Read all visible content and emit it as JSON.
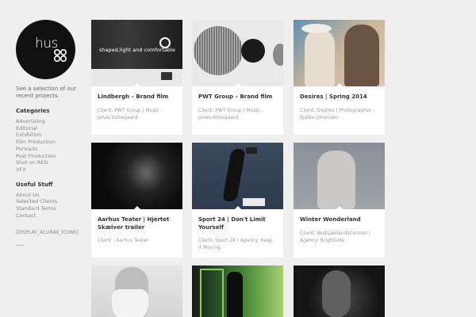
{
  "sidebar": {
    "logo_text": "hus",
    "intro": "See a selection of our recent projects.",
    "categories_title": "Categories",
    "categories": [
      "Advertising",
      "Editorial",
      "Exhibition",
      "Film Production",
      "Portraits",
      "Post Production",
      "Shot on RED",
      "VFX"
    ],
    "useful_title": "Useful Stuff",
    "useful": [
      "About Us",
      "Selected Clients",
      "Standard Terms",
      "Contact"
    ],
    "shortcode": "[DISPLAY_ACURAX_ICONS]"
  },
  "projects": [
    {
      "title": "Lindbergh – Brand film",
      "client": "Client: PWT Group | Music : Jonas Kirkegaard",
      "thumb_caption": "shaped,light and comfortable"
    },
    {
      "title": "PWT Group – Brand film",
      "client": "Client: PWT Group | Music : Jonas Kirkegaard"
    },
    {
      "title": "Desires | Spring 2014",
      "client": "Client:  Desires | Photographer : Bjarke Johansen"
    },
    {
      "title": "Aarhus Teater | Hjertet Skælver trailer",
      "client": "Client : Aarhus Teater"
    },
    {
      "title": "Sport 24 | Don't Limit Yourself",
      "client": "Client: Sport 24 | Agency: Keep It Moving"
    },
    {
      "title": "Winter Wonderland",
      "client": "Client: VestsjællandsCentret | Agency: Brightside"
    },
    {
      "title": "",
      "client": ""
    },
    {
      "title": "",
      "client": ""
    },
    {
      "title": "",
      "client": ""
    }
  ]
}
